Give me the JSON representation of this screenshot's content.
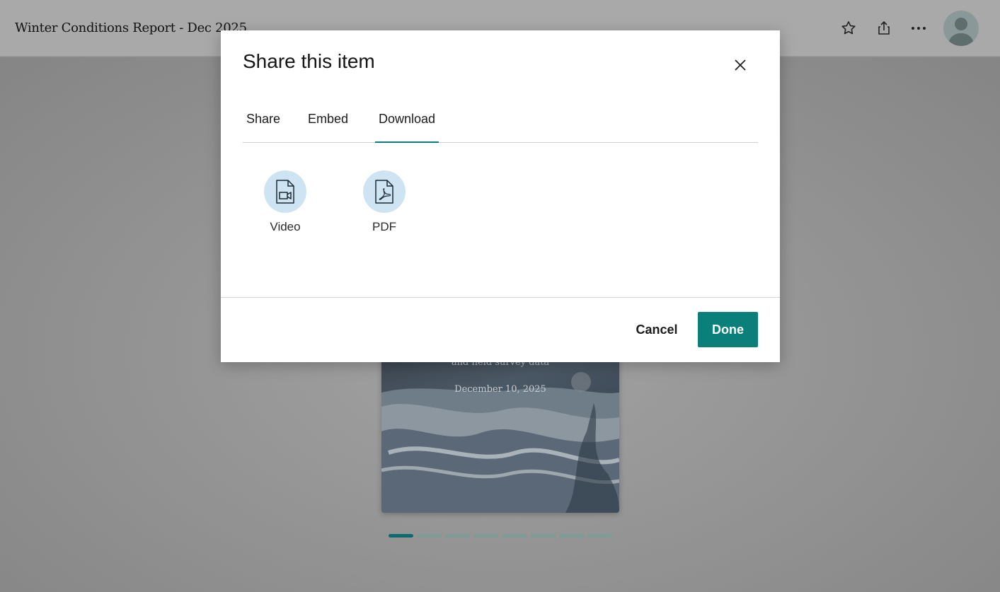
{
  "header": {
    "title": "Winter Conditions Report - Dec 2025",
    "icons": [
      "star-icon",
      "share-icon",
      "more-icon",
      "avatar"
    ]
  },
  "story_card": {
    "subtitle": "and field survey data",
    "date": "December 10, 2025"
  },
  "pagination": {
    "count": 8,
    "active_index": 0
  },
  "modal": {
    "title": "Share this item",
    "tabs": [
      {
        "label": "Share"
      },
      {
        "label": "Embed"
      },
      {
        "label": "Download"
      }
    ],
    "active_tab": "Download",
    "download_options": [
      {
        "label": "Video",
        "icon": "video-file-icon"
      },
      {
        "label": "PDF",
        "icon": "pdf-file-icon"
      }
    ],
    "cancel_label": "Cancel",
    "done_label": "Done"
  },
  "colors": {
    "accent": "#0b7f7a",
    "icon_circle": "#cfe4f2",
    "overlay": "#8f8f8f"
  }
}
